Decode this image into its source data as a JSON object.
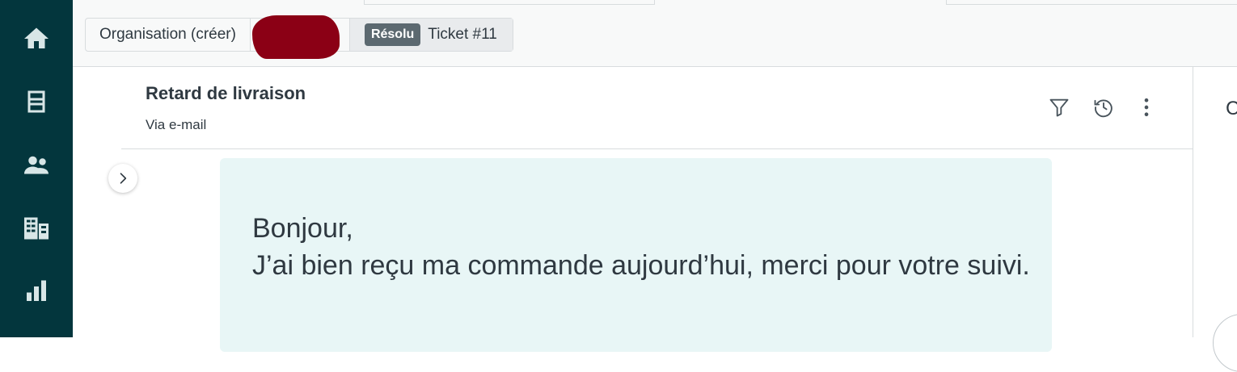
{
  "sidebar": {
    "items": [
      {
        "name": "home-icon"
      },
      {
        "name": "inbox-icon"
      },
      {
        "name": "users-icon"
      },
      {
        "name": "organizations-icon"
      },
      {
        "name": "reports-icon"
      }
    ]
  },
  "breadcrumb": {
    "organisation": "Organisation (créer)",
    "status_badge": "Résolu",
    "ticket_label": "Ticket #11"
  },
  "ticket": {
    "subject": "Retard de livraison",
    "channel": "Via e-mail",
    "message_line1": "Bonjour,",
    "message_line2": "J’ai bien reçu ma commande aujourd’hui, merci pour votre suivi."
  },
  "right_panel": {
    "truncated_text": "C"
  },
  "colors": {
    "sidebar": "#03363d",
    "message_bg": "#e8f6f6",
    "badge": "#5c6970",
    "redaction": "#8b0015"
  }
}
